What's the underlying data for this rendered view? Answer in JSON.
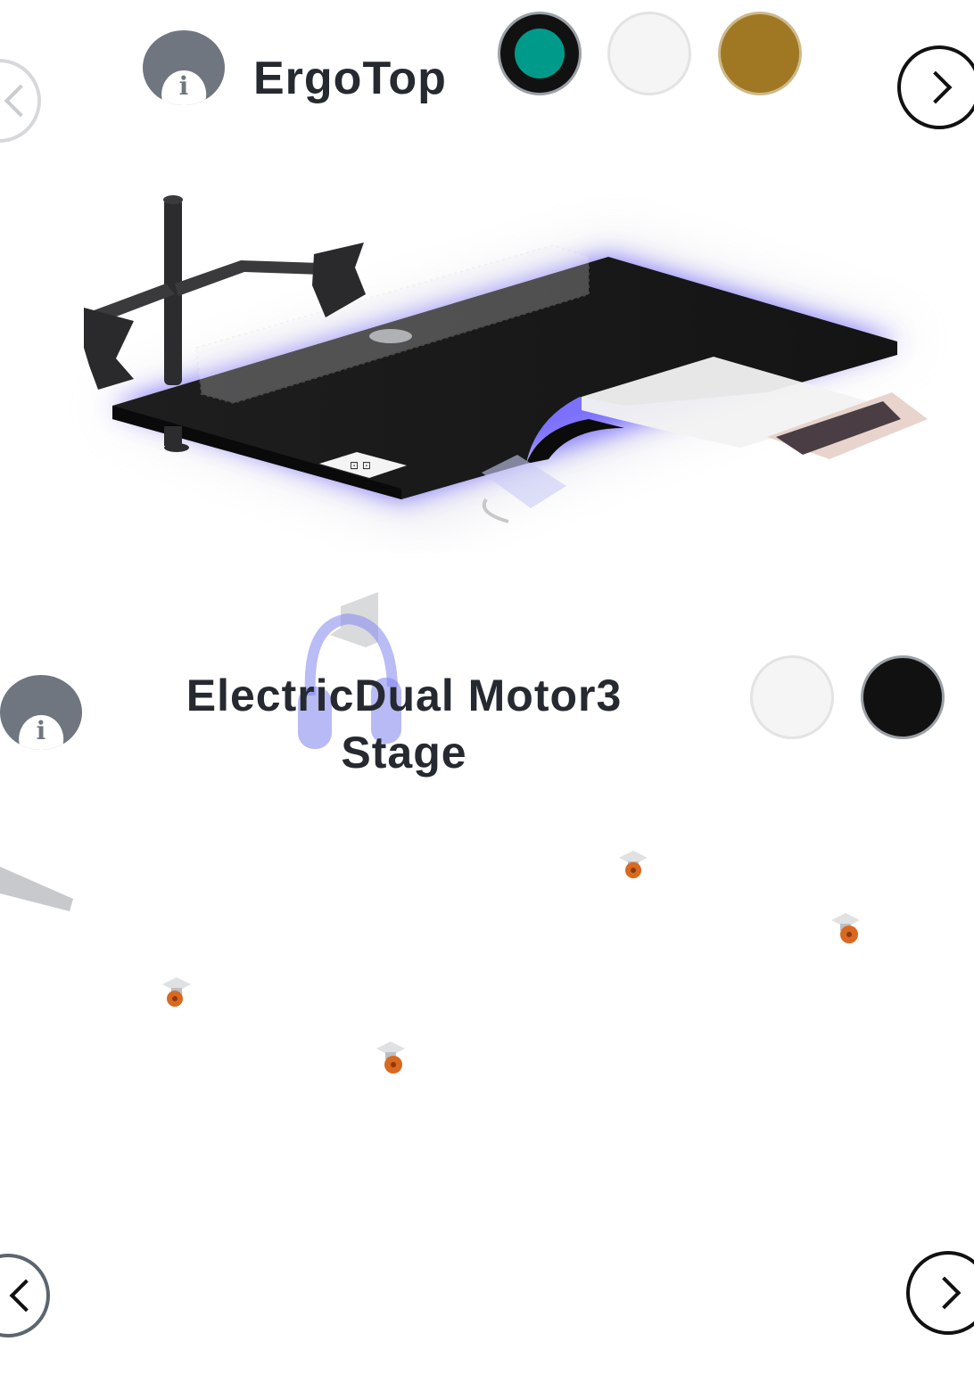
{
  "top_section": {
    "title": "ErgoTop",
    "info_label": "i",
    "colors": [
      "#009a8a",
      "#f5f5f5",
      "#a07824"
    ],
    "selected_color": "#009a8a"
  },
  "bottom_section": {
    "title": "ElectricDual Motor3 Stage",
    "title_line1": "ElectricDual Motor3",
    "title_line2": "Stage",
    "info_label": "i",
    "colors": [
      "#f5f5f5",
      "#111111"
    ]
  },
  "desk_accessories": {
    "surface_color": "#1b1b1b",
    "glow_color": "#6a5cff",
    "outlet_label": "⊡ ⊡"
  },
  "icons": {
    "info": "info-icon",
    "prev": "chevron-left-icon",
    "next": "chevron-right-icon"
  }
}
